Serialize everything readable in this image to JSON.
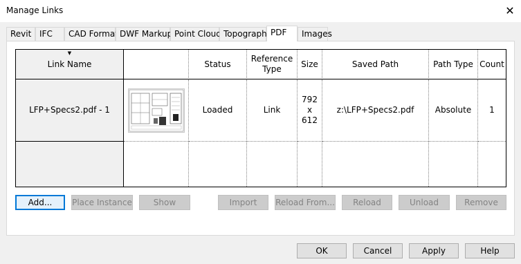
{
  "window": {
    "title": "Manage Links",
    "close_glyph": "✕"
  },
  "tabs": [
    {
      "label": "Revit",
      "active": false
    },
    {
      "label": "IFC",
      "active": false
    },
    {
      "label": "CAD Formats",
      "active": false
    },
    {
      "label": "DWF Markups",
      "active": false
    },
    {
      "label": "Point Clouds",
      "active": false
    },
    {
      "label": "Topography",
      "active": false
    },
    {
      "label": "PDF",
      "active": true
    },
    {
      "label": "Images",
      "active": false
    }
  ],
  "table": {
    "sort_glyph": "▼",
    "headers": {
      "link_name": "Link Name",
      "preview": "",
      "status": "Status",
      "reference_type": "Reference Type",
      "size": "Size",
      "saved_path": "Saved Path",
      "path_type": "Path Type",
      "count": "Count"
    },
    "rows": [
      {
        "link_name": "LFP+Specs2.pdf - 1",
        "status": "Loaded",
        "reference_type": "Link",
        "size": "792 x 612",
        "saved_path": "z:\\LFP+Specs2.pdf",
        "path_type": "Absolute",
        "count": "1"
      }
    ]
  },
  "actions": {
    "add": "Add...",
    "place_instance": "Place Instance",
    "show": "Show",
    "import": "Import",
    "reload_from": "Reload From...",
    "reload": "Reload",
    "unload": "Unload",
    "remove": "Remove"
  },
  "footer": {
    "ok": "OK",
    "cancel": "Cancel",
    "apply": "Apply",
    "help": "Help"
  }
}
